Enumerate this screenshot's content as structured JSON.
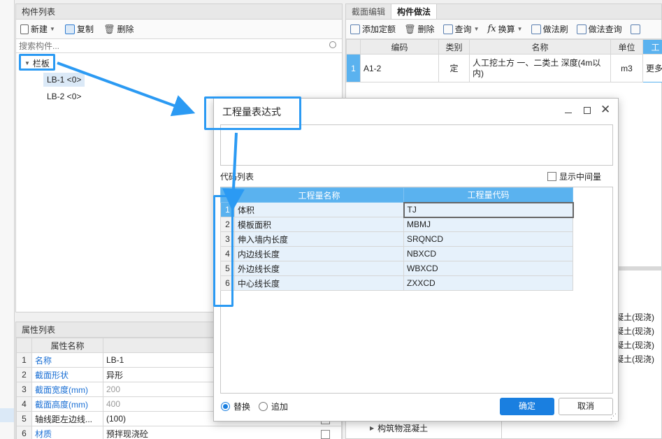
{
  "left_panel": {
    "component_list_title": "构件列表",
    "toolbar": {
      "new_label": "新建",
      "copy_label": "复制",
      "delete_label": "删除"
    },
    "search_placeholder": "搜索构件...",
    "tree": {
      "group_label": "栏板",
      "items": [
        {
          "label": "LB-1 <0>"
        },
        {
          "label": "LB-2 <0>"
        }
      ]
    },
    "property_list_title": "属性列表",
    "property_table": {
      "headers": [
        "属性名称",
        "属性"
      ],
      "rows": [
        {
          "num": "1",
          "name": "名称",
          "value": "LB-1"
        },
        {
          "num": "2",
          "name": "截面形状",
          "value": "异形"
        },
        {
          "num": "3",
          "name": "截面宽度(mm)",
          "value": "200"
        },
        {
          "num": "4",
          "name": "截面高度(mm)",
          "value": "400"
        },
        {
          "num": "5",
          "name": "轴线距左边线...",
          "value": "(100)"
        },
        {
          "num": "6",
          "name": "材质",
          "value": "预拌现浇砼"
        }
      ]
    }
  },
  "right_panel": {
    "tabs": [
      {
        "label": "截面编辑"
      },
      {
        "label": "构件做法"
      }
    ],
    "toolbar": {
      "add_quota_label": "添加定额",
      "delete_label": "删除",
      "query_label": "查询",
      "convert_label": "换算",
      "method_brush_label": "做法刷",
      "method_query_label": "做法查询"
    },
    "table": {
      "headers": [
        "编码",
        "类别",
        "名称",
        "单位",
        "工"
      ],
      "rows": [
        {
          "num": "1",
          "code": "A1-2",
          "category": "定",
          "name": "人工挖土方 一、二类土 深度(4m以内)",
          "unit": "m3",
          "extra": "更多"
        }
      ]
    },
    "lower_items": [
      "凝土(现浇)",
      "凝土(现浇)",
      "凝土(现浇)",
      "凝土(现浇)"
    ],
    "tree_item": "构筑物混凝土"
  },
  "dialog": {
    "title": "工程量表达式",
    "code_list_label": "代码列表",
    "show_intermediate_label": "显示中间量",
    "table_headers": [
      "工程量名称",
      "工程量代码"
    ],
    "rows": [
      {
        "num": "1",
        "name": "体积",
        "code": "TJ"
      },
      {
        "num": "2",
        "name": "模板面积",
        "code": "MBMJ"
      },
      {
        "num": "3",
        "name": "伸入墙内长度",
        "code": "SRQNCD"
      },
      {
        "num": "4",
        "name": "内边线长度",
        "code": "NBXCD"
      },
      {
        "num": "5",
        "name": "外边线长度",
        "code": "WBXCD"
      },
      {
        "num": "6",
        "name": "中心线长度",
        "code": "ZXXCD"
      }
    ],
    "radio_replace_label": "替换",
    "radio_append_label": "追加",
    "ok_label": "确定",
    "cancel_label": "取消"
  },
  "colors": {
    "accent": "#2b9af3",
    "header_blue": "#5ab2ef",
    "row_highlight": "#e6f1fb",
    "ok_button": "#1a7fe0"
  }
}
